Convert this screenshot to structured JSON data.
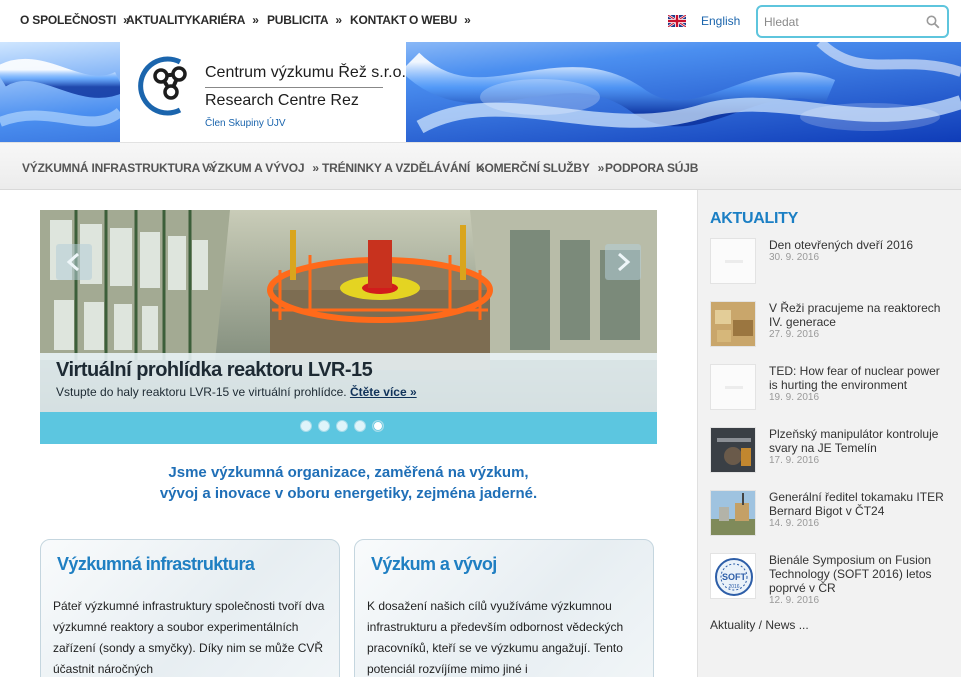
{
  "topnav": {
    "items": [
      {
        "label": "O SPOLEČNOSTI",
        "chevron": "»"
      },
      {
        "label": "AKTUALITY",
        "chevron": ""
      },
      {
        "label": "KARIÉRA",
        "chevron": "»"
      },
      {
        "label": "PUBLICITA",
        "chevron": "»"
      },
      {
        "label": "KONTAKT",
        "chevron": ""
      },
      {
        "label": "O WEBU",
        "chevron": "»"
      }
    ],
    "language": {
      "label": "English",
      "flag_icon": "uk-flag-icon"
    },
    "search": {
      "placeholder": "Hledat",
      "icon": "search-icon"
    }
  },
  "logo": {
    "line1": "Centrum výzkumu Řež s.r.o.",
    "line2": "Research Centre Rez",
    "line3": "Člen Skupiny ÚJV"
  },
  "subnav": {
    "items": [
      {
        "label": "VÝZKUMNÁ INFRASTRUKTURA",
        "chevron": "»"
      },
      {
        "label": "VÝZKUM A VÝVOJ",
        "chevron": "»"
      },
      {
        "label": "TRÉNINKY A VZDĚLÁVÁNÍ",
        "chevron": "»"
      },
      {
        "label": "KOMERČNÍ SLUŽBY",
        "chevron": "»"
      },
      {
        "label": "PODPORA SÚJB",
        "chevron": ""
      }
    ]
  },
  "slider": {
    "title": "Virtuální prohlídka reaktoru LVR-15",
    "text": "Vstupte do haly reaktoru LVR-15 ve virtuální prohlídce.",
    "more": "Čtěte více »",
    "dots": 5,
    "active_dot": 5
  },
  "intro": {
    "line1": "Jsme výzkumná organizace, zaměřená na výzkum,",
    "line2": "vývoj a inovace v oboru energetiky, zejména jaderné."
  },
  "boxes": [
    {
      "title": "Výzkumná infrastruktura",
      "text": "Páteř výzkumné infrastruktury společnosti tvoří dva výzkumné reaktory a soubor experimentálních zařízení (sondy a smyčky). Díky nim se může CVŘ účastnit náročných"
    },
    {
      "title": "Výzkum a vývoj",
      "text": "K dosažení našich cílů využíváme výzkumnou infrastrukturu a především odbornost vědeckých pracovníků, kteří se ve výzkumu angažují. Tento potenciál rozvíjíme mimo jiné i"
    }
  ],
  "news": {
    "title": "AKTUALITY",
    "items": [
      {
        "title": "Den otevřených dveří 2016",
        "date": "30. 9. 2016",
        "thumb": "placeholder"
      },
      {
        "title": "V Řeži pracujeme na reaktorech IV. generace",
        "date": "27. 9. 2016",
        "thumb": "photo"
      },
      {
        "title": "TED: How fear of nuclear power is hurting the environment",
        "date": "19. 9. 2016",
        "thumb": "placeholder"
      },
      {
        "title": "Plzeňský manipulátor kontroluje svary na JE Temelín",
        "date": "17. 9. 2016",
        "thumb": "photo"
      },
      {
        "title": "Generální ředitel tokamaku ITER Bernard Bigot v ČT24",
        "date": "14. 9. 2016",
        "thumb": "photo"
      },
      {
        "title": "Bienále Symposium on Fusion Technology (SOFT 2016) letos poprvé v ČR",
        "date": "12. 9. 2016",
        "thumb": "soft-logo"
      }
    ],
    "more": "Aktuality / News ...",
    "soft_logo_text": "SOFT",
    "soft_logo_year": "2016"
  },
  "colors": {
    "accent": "#1b7fc4",
    "slider_bar": "#5cc6e0",
    "search_border": "#5ec5dd"
  }
}
